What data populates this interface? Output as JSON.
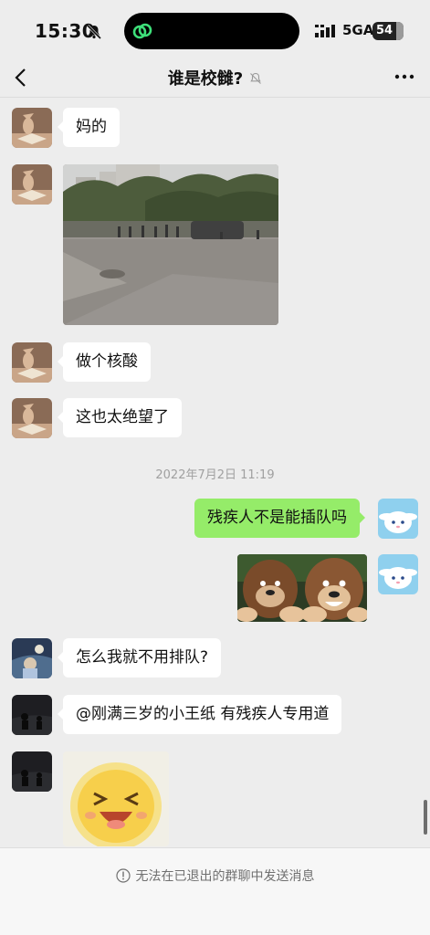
{
  "status_bar": {
    "time": "15:30",
    "network": "5GA",
    "battery": "54",
    "battery_level_percent": 54,
    "icons": [
      "bell-slash-icon",
      "link-icon",
      "signal-icon"
    ]
  },
  "nav": {
    "title": "谁是校雠?",
    "icons": [
      "back-icon",
      "mute-icon",
      "more-icon"
    ]
  },
  "messages": [
    {
      "id": "m1",
      "side": "left",
      "type": "text",
      "text": "妈的"
    },
    {
      "id": "m2",
      "side": "left",
      "type": "image",
      "description": "street photo"
    },
    {
      "id": "m3",
      "side": "left",
      "type": "text",
      "text": "做个核酸"
    },
    {
      "id": "m4",
      "side": "left",
      "type": "text",
      "text": "这也太绝望了"
    },
    {
      "id": "m5",
      "side": "right",
      "type": "text",
      "text": "残疾人不是能插队吗"
    },
    {
      "id": "m6",
      "side": "right",
      "type": "sticker"
    },
    {
      "id": "m7",
      "side": "left",
      "type": "text",
      "text": "怎么我就不用排队?"
    },
    {
      "id": "m8",
      "side": "left",
      "type": "text",
      "text": "@刚满三岁的小王纸 有残疾人专用道"
    },
    {
      "id": "m9",
      "side": "left",
      "type": "sticker"
    }
  ],
  "timestamp": "2022年7月2日 11:19",
  "footer": {
    "notice": "无法在已退出的群聊中发送消息",
    "icon": "info-icon"
  },
  "colors": {
    "background": "#ededed",
    "bubble_in": "#ffffff",
    "bubble_out": "#95ec69",
    "footer": "#f7f7f7"
  }
}
